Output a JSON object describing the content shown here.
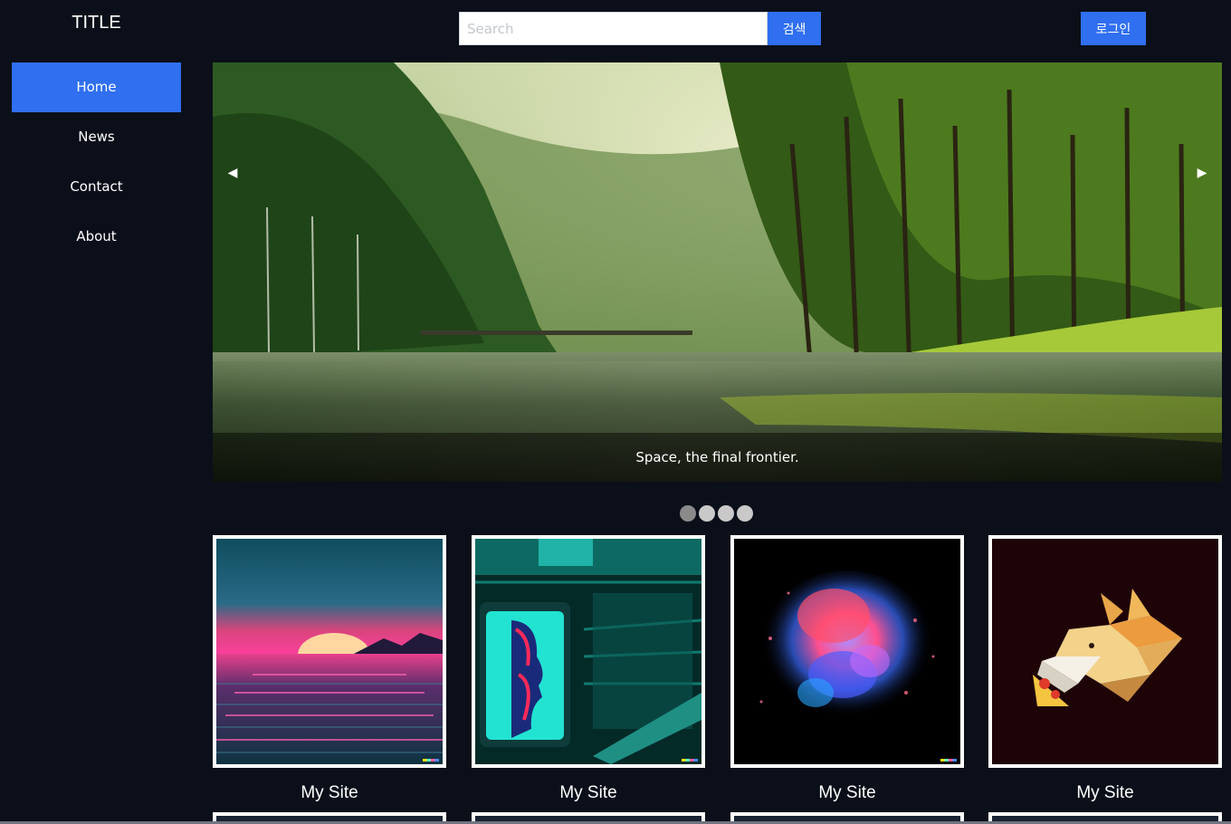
{
  "sidebar": {
    "title": "TITLE",
    "items": [
      {
        "label": "Home",
        "active": true
      },
      {
        "label": "News",
        "active": false
      },
      {
        "label": "Contact",
        "active": false
      },
      {
        "label": "About",
        "active": false
      }
    ]
  },
  "header": {
    "search_placeholder": "Search",
    "search_button": "검색",
    "login_button": "로그인"
  },
  "carousel": {
    "caption": "Space, the final frontier.",
    "prev_glyph": "◀",
    "next_glyph": "▶",
    "slide_count": 4,
    "active_slide": 1
  },
  "gallery": {
    "cards": [
      {
        "caption": "My Site",
        "image": "synthwave-sunset-ocean"
      },
      {
        "caption": "My Site",
        "image": "neon-subway-face-poster"
      },
      {
        "caption": "My Site",
        "image": "color-powder-explosion"
      },
      {
        "caption": "My Site",
        "image": "origami-fox-pizza"
      }
    ]
  },
  "colors": {
    "background": "#0b0f19",
    "accent": "#2f6ff0"
  }
}
